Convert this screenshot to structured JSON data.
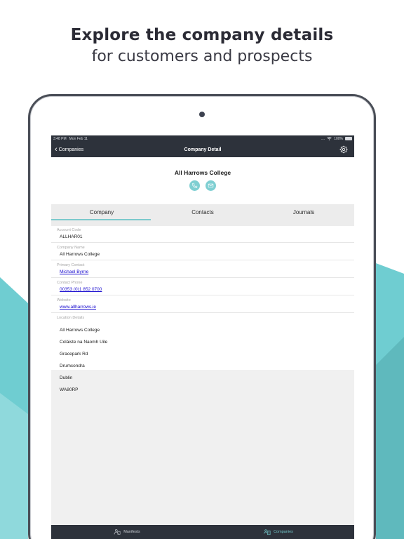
{
  "promo": {
    "headline": "Explore the company details",
    "subheadline": "for customers and prospects"
  },
  "status_bar": {
    "time": "3:48 PM",
    "date": "Mon Feb 11",
    "signal": "....",
    "battery_text": "100%"
  },
  "nav": {
    "back_label": "Companies",
    "title": "Company Detail",
    "settings_icon": "gear-icon"
  },
  "company": {
    "name": "All Harrows College",
    "actions": [
      "phone-icon",
      "mail-icon"
    ]
  },
  "tabs": [
    {
      "label": "Company",
      "active": true
    },
    {
      "label": "Contacts",
      "active": false
    },
    {
      "label": "Journals",
      "active": false
    }
  ],
  "fields": {
    "account_code": {
      "label": "Account Code",
      "value": "ALLHAR01"
    },
    "company_name": {
      "label": "Company Name",
      "value": "All Harrows College"
    },
    "primary_contact": {
      "label": "Primary Contact",
      "value": "Michael Byrne"
    },
    "contact_phone": {
      "label": "Contact Phone",
      "value": "00353 (0)1 852 0700"
    },
    "website": {
      "label": "Website",
      "value": "www.allharrows.ie"
    },
    "location": {
      "label": "Location Details",
      "lines": [
        "All Harrows College",
        "Coláiste na Naomh Uile",
        "Gracepark Rd",
        "Drumcondra",
        "Dublin",
        "WA80RP"
      ]
    }
  },
  "bottom_tabs": [
    {
      "label": "Manifests",
      "icon": "manifests-icon",
      "active": false
    },
    {
      "label": "Companies",
      "icon": "companies-icon",
      "active": true
    }
  ],
  "colors": {
    "accent": "#7cc9cc",
    "nav_bg": "#2d323b",
    "bg_shape": "#6fcdd1"
  }
}
